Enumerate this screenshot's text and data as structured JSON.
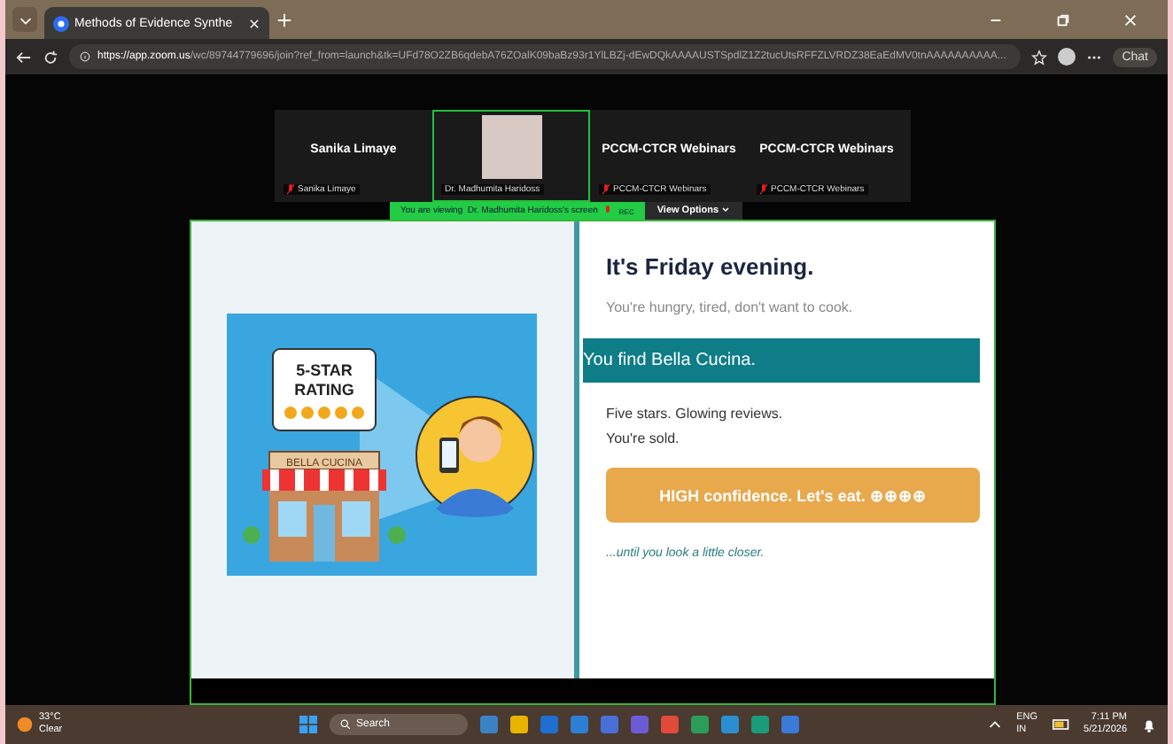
{
  "browser": {
    "tab_title": "Methods of Evidence Synthe",
    "url_host": "https://app.zoom.us",
    "url_path": "/wc/89744779696/join?ref_from=launch&tk=UFd78O2ZB6qdebA76ZOalK09baBz93r1YlLBZj-dEwDQkAAAAUSTSpdlZ1Z2tucUtsRFFZLVRDZ38EaEdMV0tnAAAAAAAAAA...",
    "chat_label": "Chat"
  },
  "participants": [
    {
      "kind": "name",
      "display": "Sanika Limaye",
      "label": "Sanika Limaye",
      "muted": true,
      "selected": false
    },
    {
      "kind": "video",
      "label": "Dr. Madhumita Haridoss",
      "muted": false,
      "selected": true
    },
    {
      "kind": "name",
      "display": "PCCM-CTCR Webinars",
      "label": "PCCM-CTCR Webinars",
      "muted": true,
      "selected": false
    },
    {
      "kind": "name",
      "display": "PCCM-CTCR Webinars",
      "label": "PCCM-CTCR Webinars",
      "muted": true,
      "selected": false
    }
  ],
  "banner": {
    "text": "You are viewing  Dr. Madhumita Haridoss's screen",
    "rec": "REC",
    "view_options": "View Options"
  },
  "slide": {
    "illustration": {
      "sign": "5-STAR RATING",
      "store": "BELLA CUCINA"
    },
    "title": "It's Friday evening.",
    "subtitle": "You're hungry, tired, don't want to cook.",
    "highlight": "You find Bella Cucina.",
    "body": [
      "Five stars. Glowing reviews.",
      "You're sold."
    ],
    "callout": "HIGH confidence. Let's eat. ⊕⊕⊕⊕",
    "footer": "...until you look a little closer."
  },
  "taskbar": {
    "temperature": "33°C",
    "weather": "Clear",
    "search": "Search",
    "lang": "ENG",
    "region": "IN",
    "time": "7:11 PM",
    "date": "5/21/2026"
  }
}
